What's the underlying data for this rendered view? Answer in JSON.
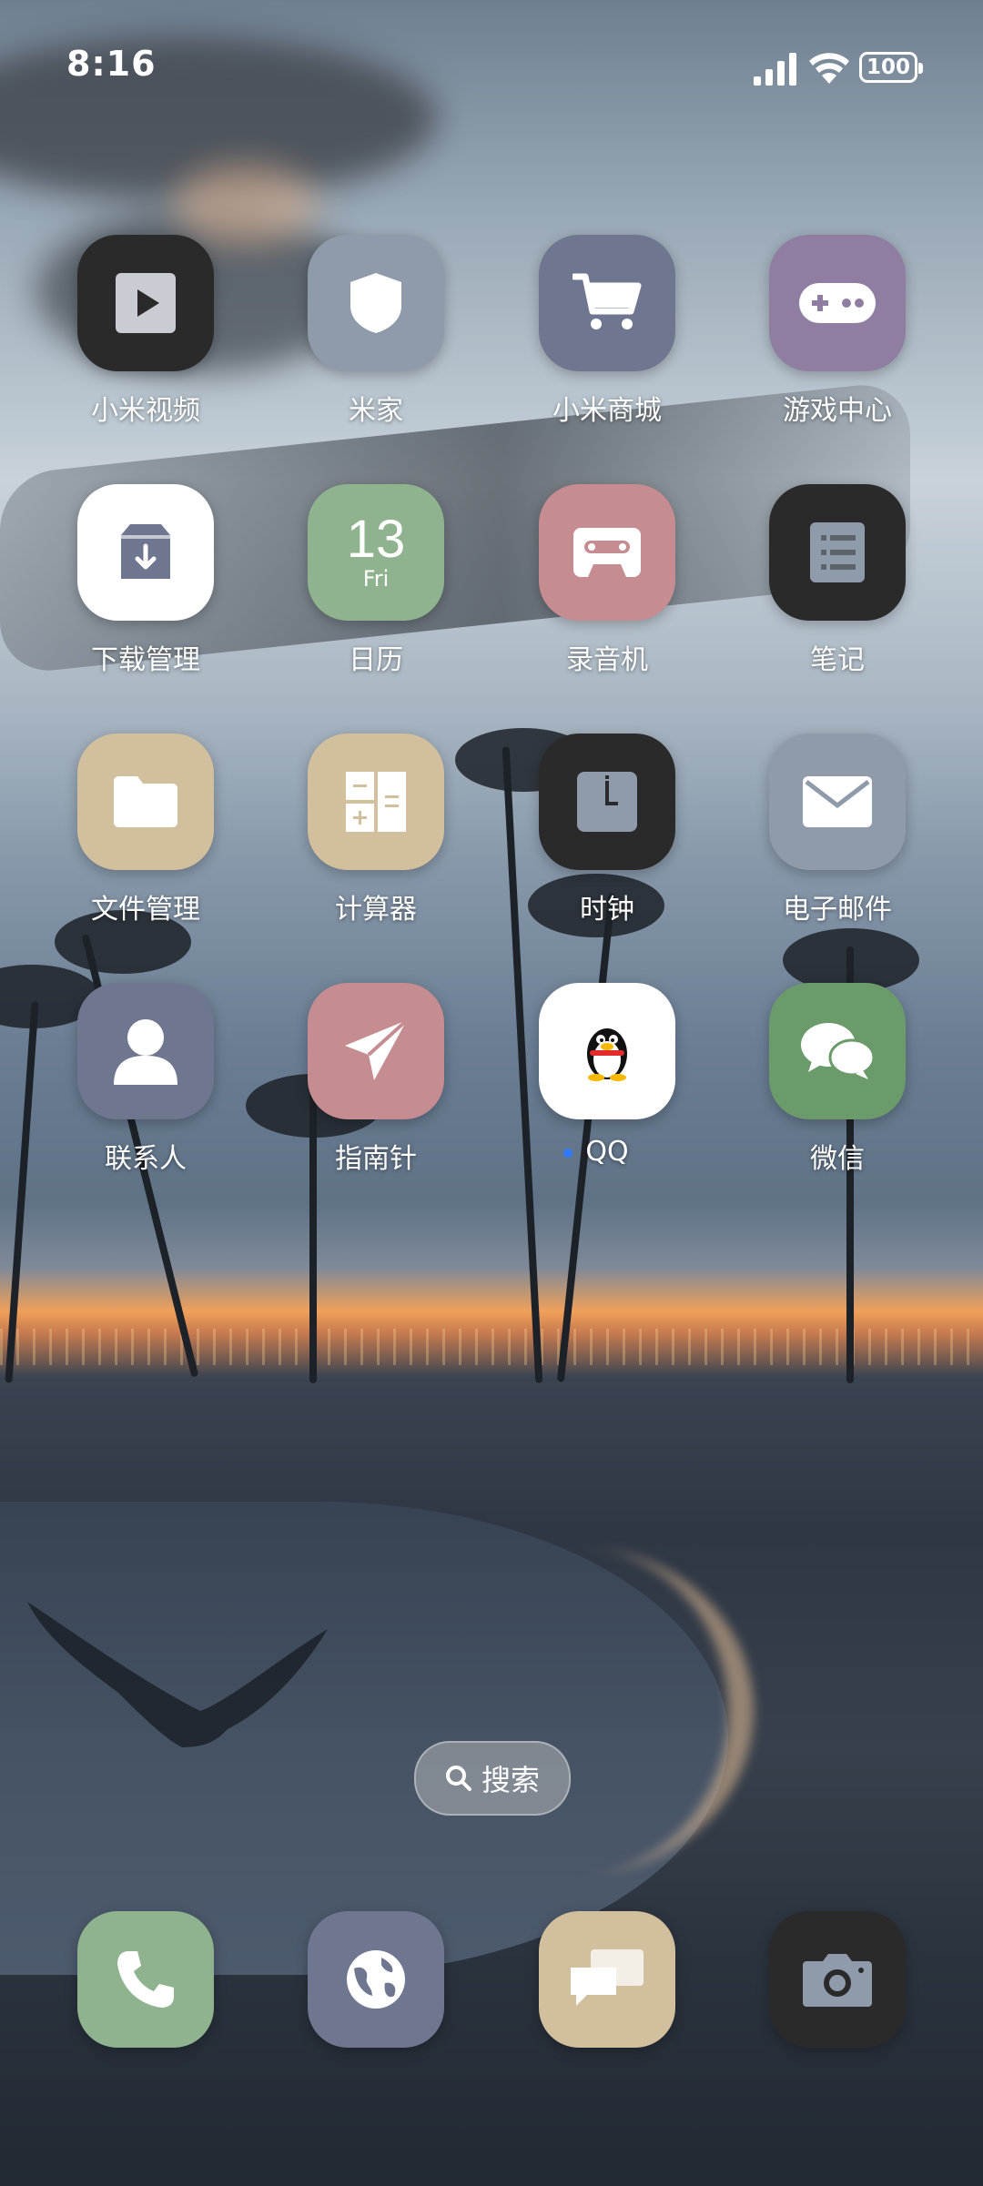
{
  "status_bar": {
    "time": "8:16",
    "battery": "100"
  },
  "apps": [
    {
      "label": "小米视频",
      "icon": "video-play-icon",
      "bg": "#2b2a2b"
    },
    {
      "label": "米家",
      "icon": "shield-icon",
      "bg": "#8f9aab"
    },
    {
      "label": "小米商城",
      "icon": "shopping-cart-icon",
      "bg": "#6e778f"
    },
    {
      "label": "游戏中心",
      "icon": "gamepad-icon",
      "bg": "#8f7ea2"
    },
    {
      "label": "下载管理",
      "icon": "download-box-icon",
      "bg": "#ffffff"
    },
    {
      "label": "日历",
      "icon": "calendar-icon",
      "bg": "#8fb38f",
      "day": "13",
      "weekday": "Fri"
    },
    {
      "label": "录音机",
      "icon": "cassette-icon",
      "bg": "#c58c91"
    },
    {
      "label": "笔记",
      "icon": "notes-icon",
      "bg": "#2b2a2b"
    },
    {
      "label": "文件管理",
      "icon": "folder-icon",
      "bg": "#d2bf9d"
    },
    {
      "label": "计算器",
      "icon": "calculator-icon",
      "bg": "#d2bf9d"
    },
    {
      "label": "时钟",
      "icon": "clock-icon",
      "bg": "#2b2a2b"
    },
    {
      "label": "电子邮件",
      "icon": "mail-icon",
      "bg": "#8f9aab"
    },
    {
      "label": "联系人",
      "icon": "contact-person-icon",
      "bg": "#6e778f"
    },
    {
      "label": "指南针",
      "icon": "paper-plane-icon",
      "bg": "#c58c91"
    },
    {
      "label": "QQ",
      "icon": "qq-penguin-icon",
      "bg": "#ffffff"
    },
    {
      "label": "微信",
      "icon": "wechat-bubbles-icon",
      "bg": "#6b9b6b"
    }
  ],
  "search": {
    "label": "搜索"
  },
  "dock": [
    {
      "icon": "phone-icon",
      "bg": "#8fb38f"
    },
    {
      "icon": "globe-icon",
      "bg": "#6e778f"
    },
    {
      "icon": "messages-icon",
      "bg": "#d2bf9d"
    },
    {
      "icon": "camera-icon",
      "bg": "#2b2a2b"
    }
  ]
}
